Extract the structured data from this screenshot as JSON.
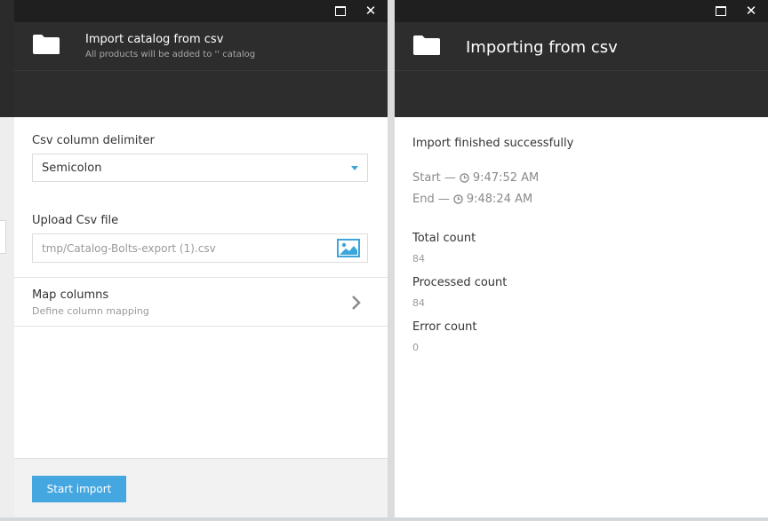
{
  "import_blade": {
    "title": "Import catalog from csv",
    "subtitle": "All products will be added to '' catalog",
    "delimiter_label": "Csv column delimiter",
    "delimiter_value": "Semicolon",
    "upload_label": "Upload Csv file",
    "upload_value": "tmp/Catalog-Bolts-export (1).csv",
    "map_title": "Map columns",
    "map_subtitle": "Define column mapping",
    "start_button": "Start import"
  },
  "progress_blade": {
    "title": "Importing from csv",
    "status": "Import finished successfully",
    "start_label": "Start —",
    "start_time": "9:47:52 AM",
    "end_label": "End —",
    "end_time": "9:48:24 AM",
    "total_label": "Total count",
    "total_value": "84",
    "processed_label": "Processed count",
    "processed_value": "84",
    "error_label": "Error count",
    "error_value": "0"
  },
  "colors": {
    "accent": "#45a7e0",
    "header_bg": "#2d2d2d",
    "titlebar_bg": "#1f1f1f"
  },
  "icons": [
    "folder-icon",
    "maximize-icon",
    "close-icon",
    "caret-down-icon",
    "image-icon",
    "chevron-right-icon",
    "clock-icon"
  ]
}
